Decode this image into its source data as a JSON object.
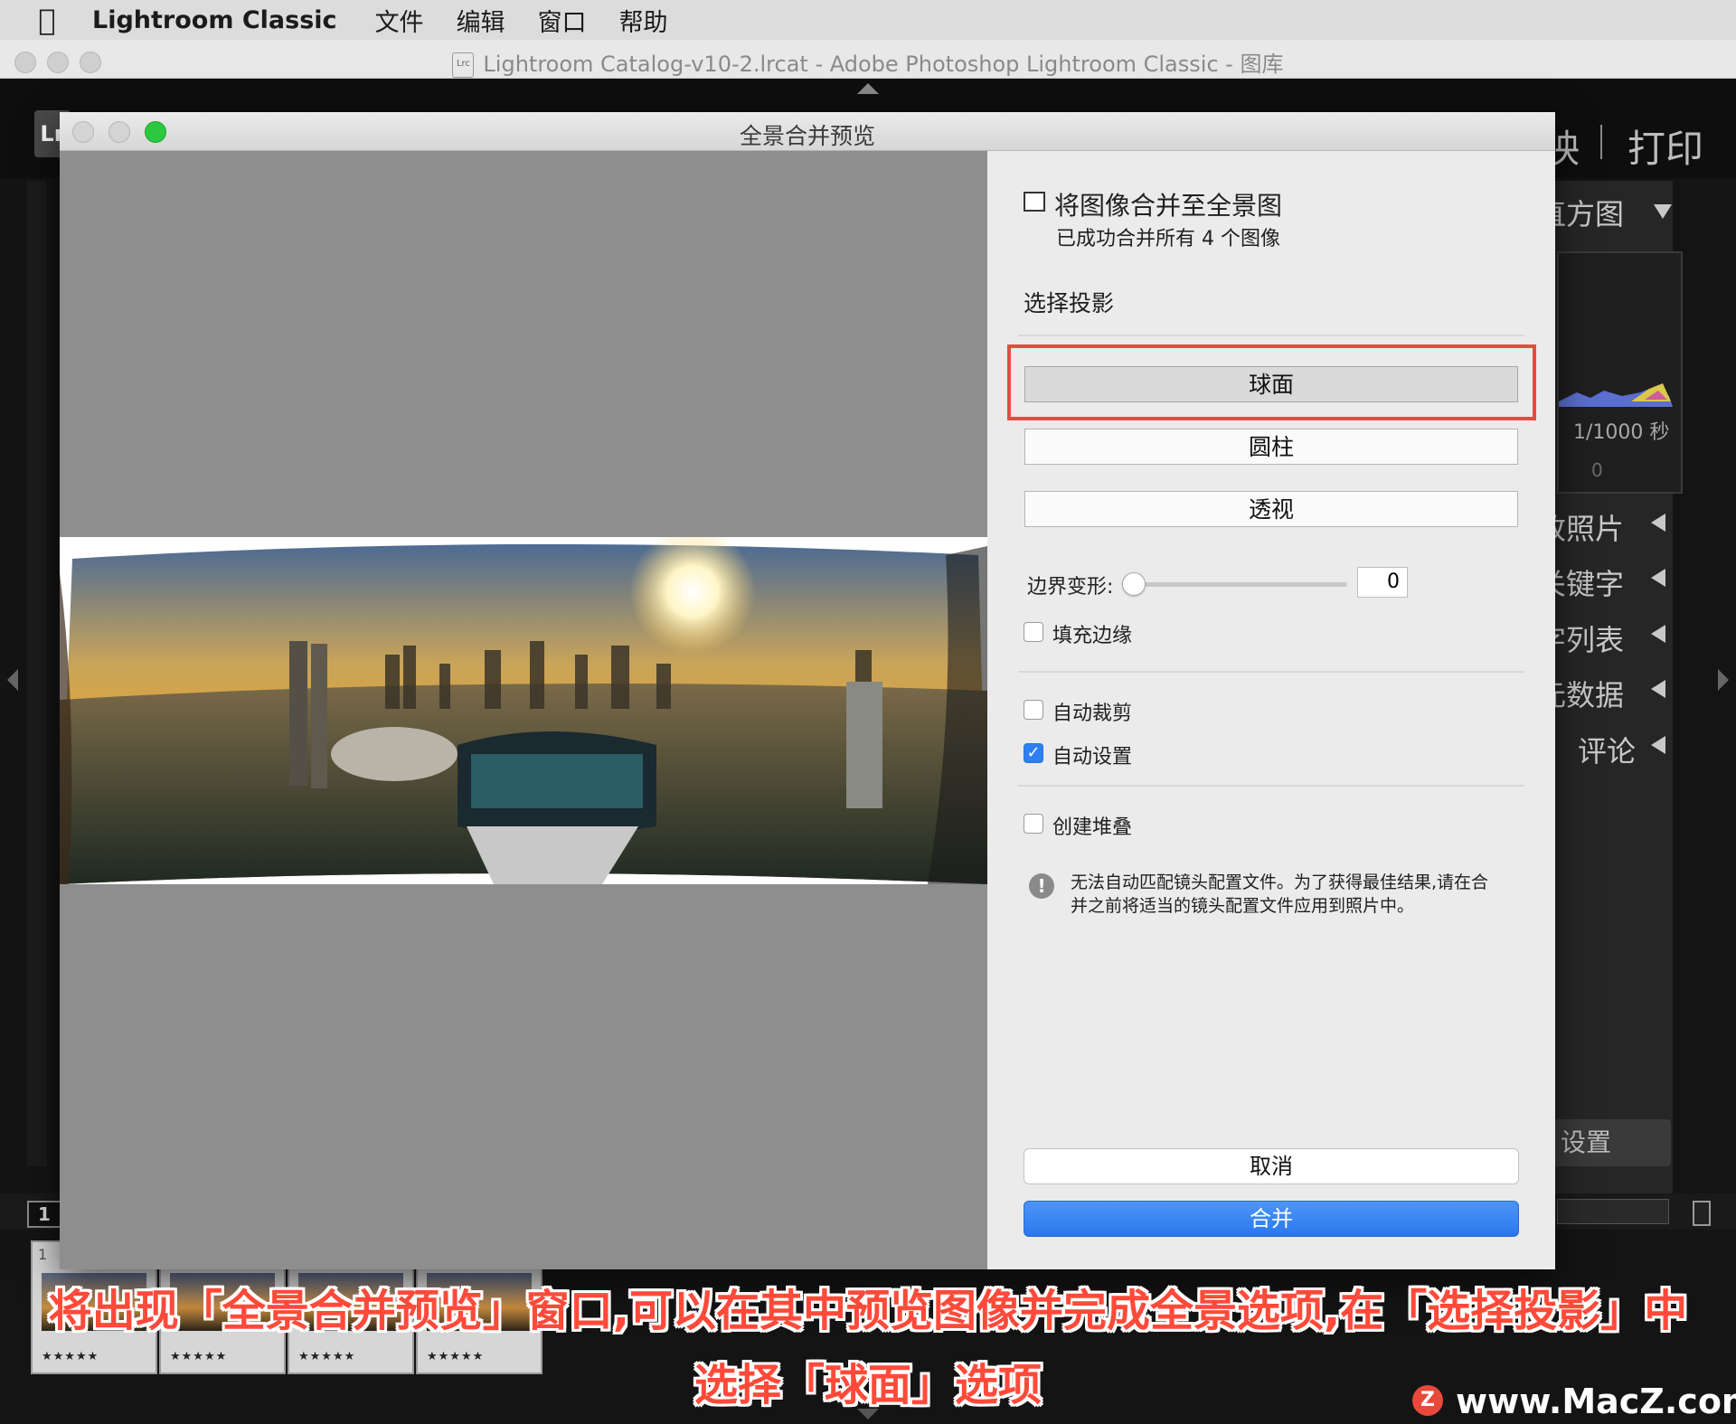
{
  "menubar": {
    "app_name": "Lightroom Classic",
    "items": [
      "文件",
      "编辑",
      "窗口",
      "帮助"
    ]
  },
  "window": {
    "title": "Lightroom Catalog-v10-2.lrcat - Adobe Photoshop Lightroom Classic - 图库",
    "icon_text": "Lrc"
  },
  "lightroom": {
    "logo": "Lr",
    "modules": {
      "prev": "映",
      "print": "打印"
    },
    "right_panel": {
      "histogram": "直方图",
      "shutter": "1/1000 秒",
      "zero": "0",
      "items": [
        "改照片",
        "关键字",
        "字列表",
        "元数据",
        "评论"
      ],
      "sync_button": "设置"
    },
    "page_number": "1",
    "filmstrip": {
      "index": "1",
      "stars": [
        "★★★★★",
        "★★★★★",
        "★★★★★",
        "★★★★★"
      ]
    }
  },
  "dialog": {
    "title": "全景合并预览",
    "merge_title": "将图像合并至全景图",
    "merge_status": "已成功合并所有 4 个图像",
    "projection_label": "选择投影",
    "projections": {
      "sphere": "球面",
      "cylinder": "圆柱",
      "perspective": "透视"
    },
    "boundary_warp_label": "边界变形:",
    "boundary_warp_value": "0",
    "boundary_warp_level": 0,
    "options": {
      "fill_edges": "填充边缘",
      "auto_crop": "自动裁剪",
      "auto_settings": "自动设置",
      "create_stack": "创建堆叠"
    },
    "warning": "无法自动匹配镜头配置文件。为了获得最佳结果,请在合并之前将适当的镜头配置文件应用到照片中。",
    "cancel": "取消",
    "merge": "合并"
  },
  "caption": {
    "line1": "将出现「全景合并预览」窗口,可以在其中预览图像并完成全景选项,在「选择投影」中",
    "line2": "选择「球面」选项"
  },
  "watermark": {
    "logo": "Z",
    "text": "www.MacZ.com"
  },
  "colors": {
    "highlight": "#e54b43",
    "primary_button": "#2a77ec",
    "caption": "#ff4a3a"
  }
}
